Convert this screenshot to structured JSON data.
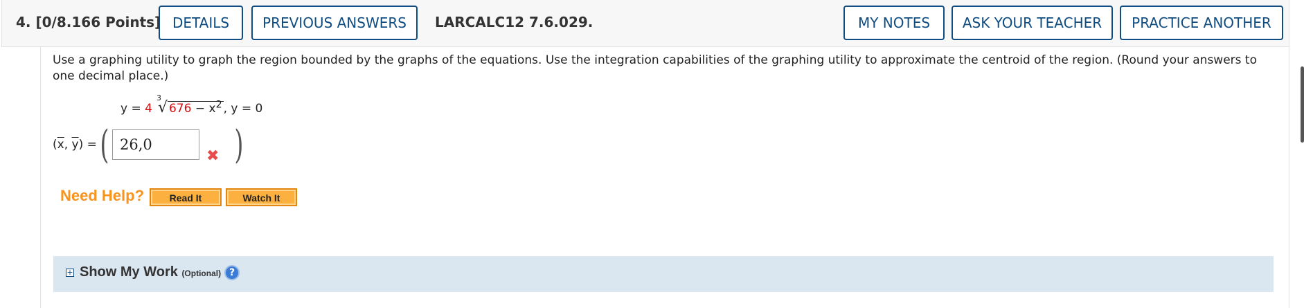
{
  "header": {
    "question_number": "4.",
    "points": "[0/8.166 Points]",
    "details_label": "DETAILS",
    "previous_answers_label": "PREVIOUS ANSWERS",
    "problem_code": "LARCALC12 7.6.029.",
    "my_notes_label": "MY NOTES",
    "ask_teacher_label": "ASK YOUR TEACHER",
    "practice_another_label": "PRACTICE ANOTHER"
  },
  "question": {
    "prompt": "Use a graphing utility to graph the region bounded by the graphs of the equations. Use the integration capabilities of the graphing utility to approximate the centroid of the region. (Round your answers to one decimal place.)",
    "equation": {
      "lhs": "y = ",
      "coef": "4",
      "root_index": "3",
      "radicand_number": "676",
      "radicand_rest": " − x",
      "exponent": "2",
      "suffix": ", y = 0"
    },
    "coord_label": {
      "open": "(",
      "x": "x",
      "sep": ", ",
      "y": "y",
      "close": ") ="
    },
    "answer_value": "26,0",
    "answer_status": "incorrect",
    "incorrect_mark": "✖",
    "paren_open": "(",
    "paren_close": ")"
  },
  "help": {
    "label": "Need Help?",
    "read_it": "Read It",
    "watch_it": "Watch It"
  },
  "show_my_work": {
    "toggle": "+",
    "label": "Show My Work",
    "optional": "(Optional)",
    "help_icon": "?"
  },
  "colors": {
    "accent": "#0f4c81",
    "error": "#e84b4b",
    "need_help": "#f7931e",
    "help_button": "#fbb040",
    "work_panel": "#dae6f0"
  },
  "icons": [
    "close-icon",
    "expand-icon",
    "help-icon"
  ]
}
